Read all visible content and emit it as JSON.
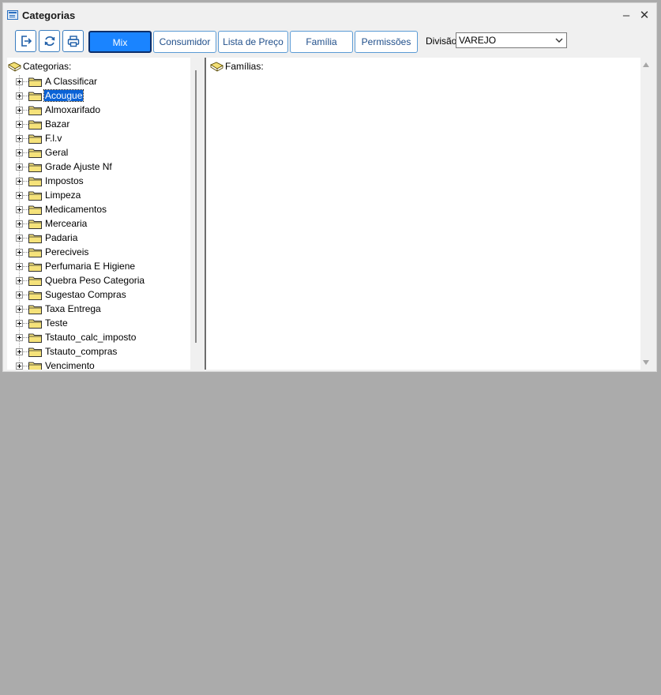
{
  "window": {
    "title": "Categorias",
    "minimize_glyph": "–",
    "close_glyph": "✕"
  },
  "toolbar": {
    "icons": [
      "exit-icon",
      "refresh-icon",
      "print-icon"
    ],
    "tabs": [
      "Mix",
      "Consumidor",
      "Lista de Preço",
      "Família",
      "Permissões"
    ],
    "active_tab": "Mix",
    "divisao_label": "Divisão",
    "divisao_value": "VAREJO"
  },
  "categories": {
    "root_label": "Categorias:",
    "items": [
      " A Classificar",
      "Acougue",
      "Almoxarifado",
      "Bazar",
      "F.l.v",
      "Geral",
      "Grade Ajuste Nf",
      "Impostos",
      "Limpeza",
      "Medicamentos",
      "Mercearia",
      "Padaria",
      "Pereciveis",
      "Perfumaria E Higiene",
      "Quebra Peso Categoria",
      "Sugestao Compras",
      "Taxa Entrega",
      "Teste",
      "Tstauto_calc_imposto",
      "Tstauto_compras",
      "Vencimento"
    ],
    "selected": "Acougue"
  },
  "families": {
    "root_label": "Famílias:"
  },
  "colors": {
    "active_tab_bg": "#1a84ff",
    "selection_bg": "#0a62d6",
    "folder_fill": "#f5e27a"
  }
}
